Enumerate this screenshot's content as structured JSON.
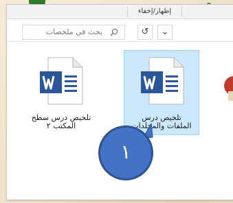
{
  "ribbon": {
    "tab_label": "إظهار/إخفاء"
  },
  "search": {
    "placeholder": "بحث في ملخصات"
  },
  "toolbar": {
    "refresh_label": "↺",
    "dropdown_label": "⌄"
  },
  "files": [
    {
      "label": "تلخيص درس الملفات والمجلدات",
      "icon": "word-document-icon",
      "selected": true
    },
    {
      "label": "تلخيص درس سطح المكتب ٢",
      "icon": "word-document-icon",
      "selected": false
    }
  ],
  "annotation": {
    "step_number": "١"
  },
  "colors": {
    "word_blue": "#2b579a",
    "selection": "#cce8ff",
    "badge": "#4472c4"
  }
}
